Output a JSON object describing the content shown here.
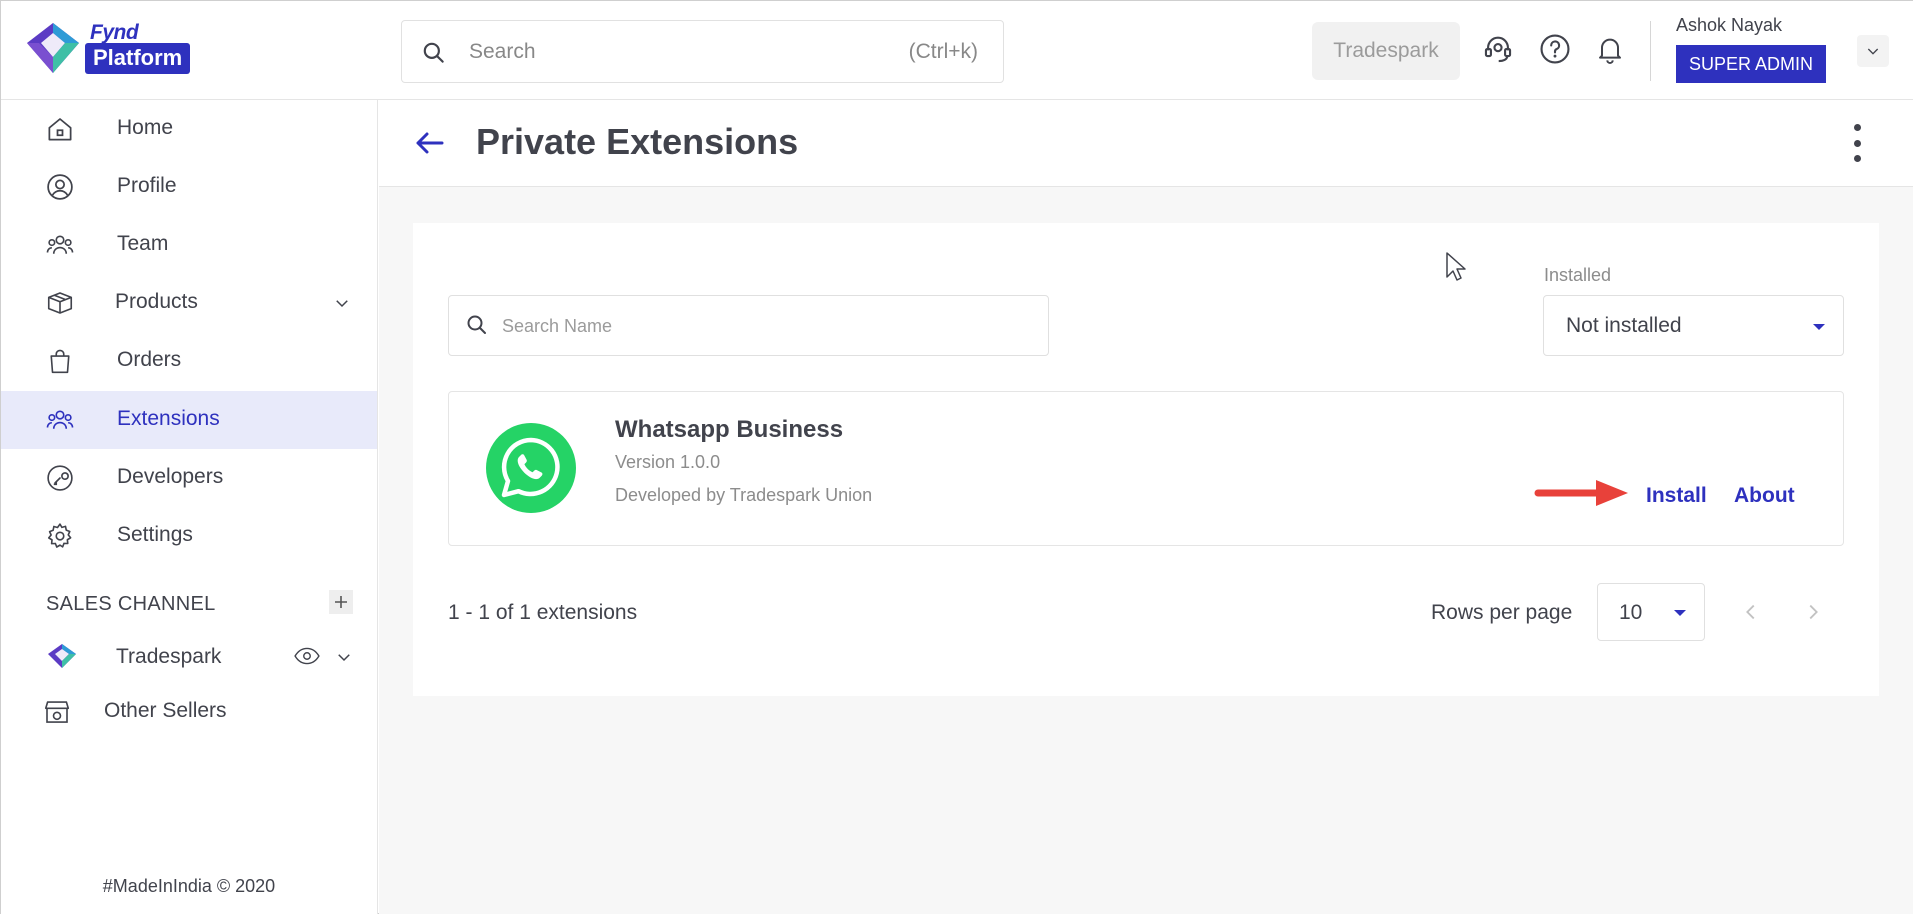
{
  "brand": {
    "top": "Fynd",
    "pill": "Platform"
  },
  "search": {
    "placeholder": "Search",
    "shortcut": "(Ctrl+k)"
  },
  "company": {
    "name": "Tradespark"
  },
  "user": {
    "name": "Ashok Nayak",
    "role": "SUPER ADMIN"
  },
  "icons": {
    "support": "headset-icon",
    "help": "question-circle-icon",
    "notifications": "bell-icon"
  },
  "sidebar": {
    "items": [
      {
        "label": "Home",
        "icon": "home-icon"
      },
      {
        "label": "Profile",
        "icon": "user-circle-icon"
      },
      {
        "label": "Team",
        "icon": "team-icon"
      },
      {
        "label": "Products",
        "icon": "box-icon"
      },
      {
        "label": "Orders",
        "icon": "shopping-bag-icon"
      },
      {
        "label": "Extensions",
        "icon": "extensions-icon"
      },
      {
        "label": "Developers",
        "icon": "developers-icon"
      },
      {
        "label": "Settings",
        "icon": "gear-icon"
      }
    ],
    "active": "Extensions",
    "sales_channel_title": "SALES CHANNEL",
    "channels": [
      {
        "label": "Tradespark"
      }
    ],
    "other_sellers": "Other Sellers",
    "footer": "#MadeInIndia © 2020"
  },
  "page": {
    "title": "Private Extensions"
  },
  "filters": {
    "search_placeholder": "Search Name",
    "installed_label": "Installed",
    "installed_value": "Not installed"
  },
  "extensions": [
    {
      "name": "Whatsapp Business",
      "version": "Version 1.0.0",
      "developer": "Developed by Tradespark Union",
      "install_label": "Install",
      "about_label": "About"
    }
  ],
  "pagination": {
    "count_text": "1 - 1 of 1 extensions",
    "rows_label": "Rows per page",
    "rows_value": "10"
  },
  "colors": {
    "accent": "#2e31be",
    "active_bg": "#e8eafa",
    "whatsapp": "#25d366",
    "annotation_arrow": "#e8413a"
  }
}
